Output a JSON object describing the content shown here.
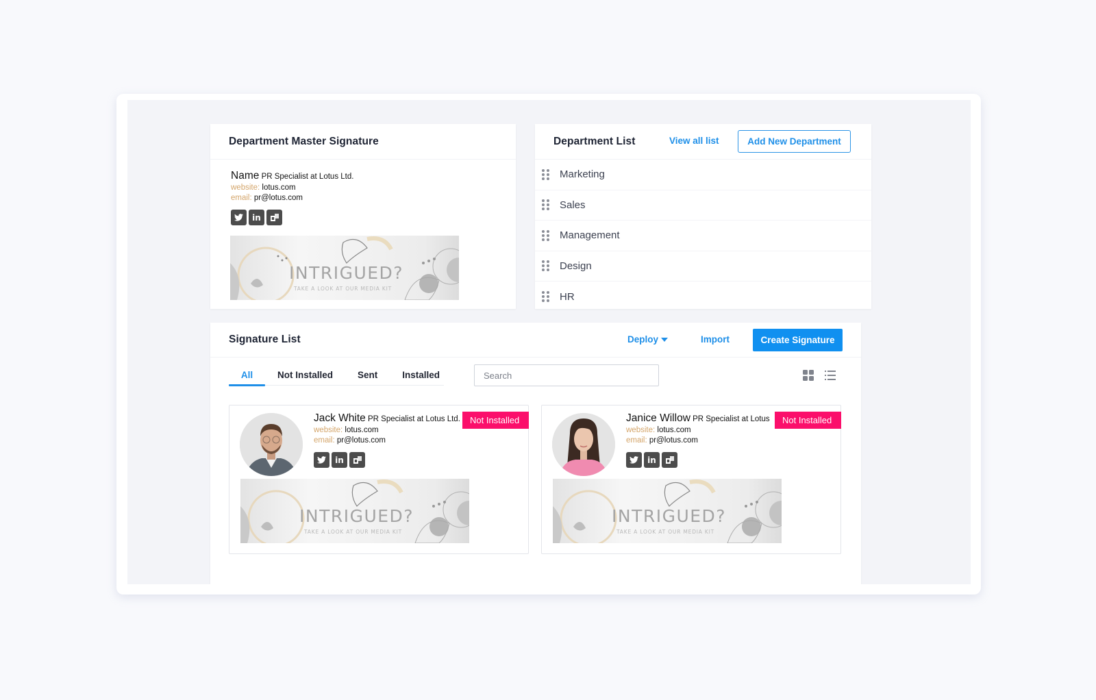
{
  "master_signature": {
    "title": "Department Master Signature",
    "signature": {
      "name": "Name",
      "role": "PR Specialist at Lotus Ltd.",
      "website_label": "website:",
      "website": "lotus.com",
      "email_label": "email:",
      "email": "pr@lotus.com",
      "socials": [
        "twitter-icon",
        "linkedin-icon",
        "outlook-icon"
      ],
      "banner_title": "INTRIGUED?",
      "banner_subtitle": "TAKE A LOOK AT OUR MEDIA KIT"
    }
  },
  "department_list": {
    "title": "Department List",
    "view_all_label": "View all list",
    "add_button_label": "Add New Department",
    "items": [
      {
        "label": "Marketing"
      },
      {
        "label": "Sales"
      },
      {
        "label": "Management"
      },
      {
        "label": "Design"
      },
      {
        "label": "HR"
      }
    ]
  },
  "signature_list": {
    "title": "Signature List",
    "deploy_label": "Deploy",
    "import_label": "Import",
    "create_label": "Create Signature",
    "tabs": [
      {
        "label": "All",
        "active": true
      },
      {
        "label": "Not Installed",
        "active": false
      },
      {
        "label": "Sent",
        "active": false
      },
      {
        "label": "Installed",
        "active": false
      }
    ],
    "search_placeholder": "Search",
    "search_value": "",
    "view_modes": [
      "grid-view-icon",
      "list-view-icon"
    ],
    "active_view": "grid",
    "cards": [
      {
        "name": "Jack White",
        "role": "PR Specialist at Lotus Ltd.",
        "website_label": "website:",
        "website": "lotus.com",
        "email_label": "email:",
        "email": "pr@lotus.com",
        "status": "Not Installed",
        "banner_title": "INTRIGUED?",
        "banner_subtitle": "TAKE A LOOK AT OUR MEDIA KIT"
      },
      {
        "name": "Janice Willow",
        "role": "PR Specialist at Lotus",
        "website_label": "website:",
        "website": "lotus.com",
        "email_label": "email:",
        "email": "pr@lotus.com",
        "status": "Not Installed",
        "banner_title": "INTRIGUED?",
        "banner_subtitle": "TAKE A LOOK AT OUR MEDIA KIT"
      }
    ]
  },
  "colors": {
    "accent": "#1e8fe8",
    "primary_button": "#1090f0",
    "status_not_installed": "#fb0f6b",
    "signature_label": "#d4a56a",
    "social_icon_bg": "#4c4c4c"
  }
}
